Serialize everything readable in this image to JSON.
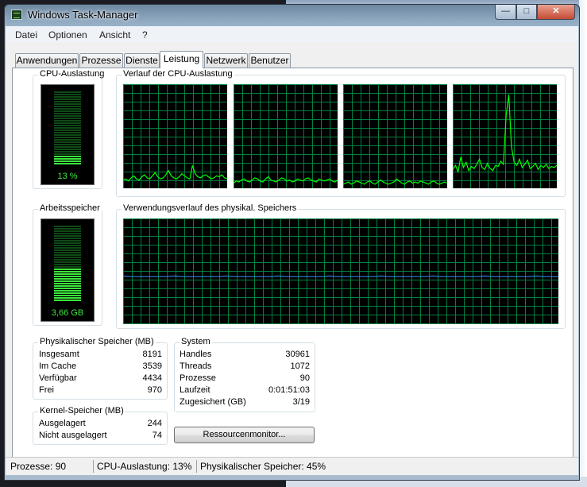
{
  "window": {
    "title": "Windows Task-Manager",
    "close_glyph": "✕",
    "minimize_glyph": "—",
    "maximize_glyph": "□"
  },
  "menu": [
    "Datei",
    "Optionen",
    "Ansicht",
    "?"
  ],
  "tabs": [
    {
      "label": "Anwendungen",
      "active": false
    },
    {
      "label": "Prozesse",
      "active": false
    },
    {
      "label": "Dienste",
      "active": false
    },
    {
      "label": "Leistung",
      "active": true
    },
    {
      "label": "Netzwerk",
      "active": false
    },
    {
      "label": "Benutzer",
      "active": false
    }
  ],
  "cpu_usage": {
    "title": "CPU-Auslastung",
    "value_label": "13 %",
    "fraction": 0.13
  },
  "cpu_history": {
    "title": "Verlauf der CPU-Auslastung",
    "cores": [
      [
        8,
        9,
        7,
        10,
        12,
        9,
        8,
        11,
        13,
        10,
        9,
        12,
        15,
        11,
        9,
        10,
        13,
        17,
        12,
        10,
        9,
        11,
        14,
        12,
        10,
        9,
        22,
        14,
        11,
        10,
        12,
        13,
        11,
        9,
        10,
        12,
        11,
        13,
        10,
        9
      ],
      [
        5,
        7,
        6,
        8,
        9,
        7,
        6,
        8,
        10,
        9,
        7,
        6,
        9,
        11,
        8,
        7,
        6,
        8,
        10,
        9,
        7,
        8,
        6,
        7,
        9,
        8,
        7,
        9,
        10,
        8,
        7,
        6,
        9,
        8,
        7,
        8,
        9,
        7,
        6,
        8
      ],
      [
        4,
        5,
        6,
        4,
        5,
        7,
        6,
        5,
        4,
        6,
        7,
        5,
        4,
        6,
        8,
        6,
        5,
        4,
        5,
        6,
        9,
        7,
        5,
        4,
        6,
        7,
        5,
        6,
        5,
        7,
        6,
        5,
        4,
        6,
        7,
        5,
        4,
        5,
        6,
        5
      ],
      [
        18,
        22,
        16,
        30,
        20,
        25,
        17,
        21,
        19,
        23,
        28,
        20,
        18,
        24,
        19,
        17,
        22,
        21,
        26,
        23,
        70,
        90,
        40,
        25,
        22,
        28,
        20,
        23,
        27,
        19,
        21,
        24,
        18,
        22,
        20,
        23,
        19,
        21,
        20,
        22
      ]
    ]
  },
  "memory_usage": {
    "title": "Arbeitsspeicher",
    "value_label": "3,66 GB",
    "fraction": 0.45
  },
  "memory_history": {
    "title": "Verwendungsverlauf des physikal. Speichers",
    "fraction": 0.45
  },
  "physical_memory": {
    "title": "Physikalischer Speicher (MB)",
    "rows": [
      {
        "label": "Insgesamt",
        "value": "8191"
      },
      {
        "label": "Im Cache",
        "value": "3539"
      },
      {
        "label": "Verfügbar",
        "value": "4434"
      },
      {
        "label": "Frei",
        "value": "970"
      }
    ]
  },
  "kernel_memory": {
    "title": "Kernel-Speicher (MB)",
    "rows": [
      {
        "label": "Ausgelagert",
        "value": "244"
      },
      {
        "label": "Nicht ausgelagert",
        "value": "74"
      }
    ]
  },
  "system": {
    "title": "System",
    "rows": [
      {
        "label": "Handles",
        "value": "30961"
      },
      {
        "label": "Threads",
        "value": "1072"
      },
      {
        "label": "Prozesse",
        "value": "90"
      },
      {
        "label": "Laufzeit",
        "value": "0:01:51:03"
      },
      {
        "label": "Zugesichert (GB)",
        "value": "3/19"
      }
    ]
  },
  "resource_monitor_button": "Ressourcenmonitor...",
  "status": {
    "processes": "Prozesse: 90",
    "cpu": "CPU-Auslastung: 13%",
    "memory": "Physikalischer Speicher: 45%"
  },
  "colors": {
    "graph_grid": "#008040",
    "graph_line": "#00ff00",
    "memory_line": "#2e7fd8",
    "meter_active": "#3ce63c",
    "meter_inactive": "#0f4a16"
  }
}
